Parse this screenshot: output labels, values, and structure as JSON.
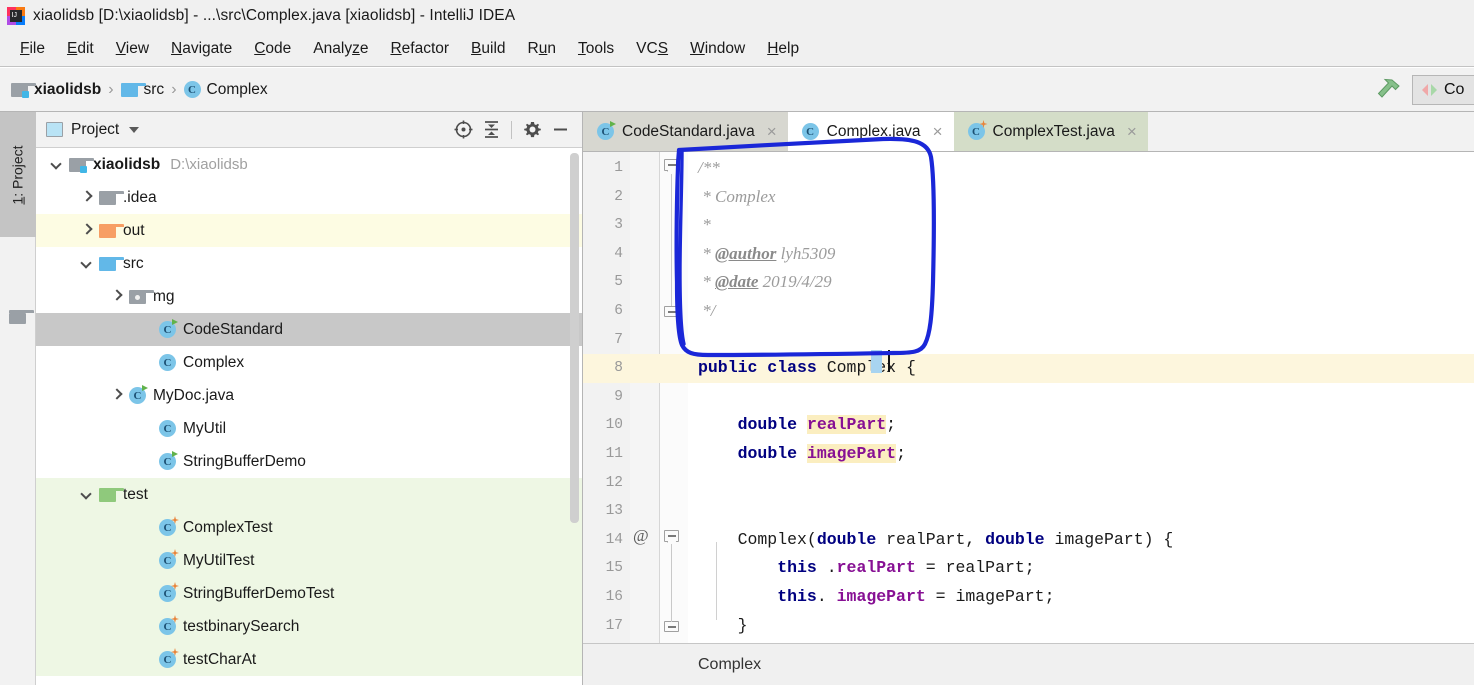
{
  "window": {
    "title": "xiaolidsb [D:\\xiaolidsb] - ...\\src\\Complex.java [xiaolidsb] - IntelliJ IDEA",
    "app_icon": "intellij-idea-icon"
  },
  "menubar": {
    "items": [
      {
        "label": "File",
        "mnemonic": "F"
      },
      {
        "label": "Edit",
        "mnemonic": "E"
      },
      {
        "label": "View",
        "mnemonic": "V"
      },
      {
        "label": "Navigate",
        "mnemonic": "N"
      },
      {
        "label": "Code",
        "mnemonic": "C"
      },
      {
        "label": "Analyze",
        "mnemonic": "z"
      },
      {
        "label": "Refactor",
        "mnemonic": "R"
      },
      {
        "label": "Build",
        "mnemonic": "B"
      },
      {
        "label": "Run",
        "mnemonic": "u"
      },
      {
        "label": "Tools",
        "mnemonic": "T"
      },
      {
        "label": "VCS",
        "mnemonic": "S"
      },
      {
        "label": "Window",
        "mnemonic": "W"
      },
      {
        "label": "Help",
        "mnemonic": "H"
      }
    ]
  },
  "navbar": {
    "breadcrumbs": [
      {
        "label": "xiaolidsb",
        "icon": "module-folder-icon",
        "bold": true
      },
      {
        "label": "src",
        "icon": "source-folder-icon",
        "bold": false
      },
      {
        "label": "Complex",
        "icon": "java-class-icon",
        "bold": false
      }
    ],
    "separator": "›",
    "build_icon": "hammer-icon",
    "toolwindow_button_label": "Co",
    "toolwindow_button_icon": "resize-arrows-icon"
  },
  "left_strip": {
    "project_tab_label": "1: Project",
    "project_tab_mnemonic": "1",
    "structure_icon": "folder-icon"
  },
  "project_panel": {
    "title": "Project",
    "title_icon": "project-view-icon",
    "dropdown_icon": "chevron-down-icon",
    "actions": [
      {
        "name": "locate-in-tree-icon",
        "tooltip": "Select Opened File"
      },
      {
        "name": "collapse-all-icon",
        "tooltip": "Collapse All"
      },
      {
        "name": "gear-icon",
        "tooltip": "Settings"
      },
      {
        "name": "minimize-icon",
        "tooltip": "Hide"
      }
    ],
    "tree": [
      {
        "label": "xiaolidsb",
        "sub": "D:\\xiaolidsb",
        "depth": 0,
        "arrow": "expanded",
        "icon": "module-folder-icon",
        "bold": true,
        "state": "normal"
      },
      {
        "label": ".idea",
        "sub": "",
        "depth": 1,
        "arrow": "collapsed",
        "icon": "gray-folder-icon",
        "bold": false,
        "state": "normal"
      },
      {
        "label": "out",
        "sub": "",
        "depth": 1,
        "arrow": "collapsed",
        "icon": "orange-folder-icon",
        "bold": false,
        "state": "excluded"
      },
      {
        "label": "src",
        "sub": "",
        "depth": 1,
        "arrow": "expanded",
        "icon": "blue-folder-icon",
        "bold": false,
        "state": "normal"
      },
      {
        "label": "mg",
        "sub": "",
        "depth": 2,
        "arrow": "collapsed",
        "icon": "package-folder-icon",
        "bold": false,
        "state": "normal"
      },
      {
        "label": "CodeStandard",
        "sub": "",
        "depth": 3,
        "arrow": "none",
        "icon": "java-class-runnable-icon",
        "bold": false,
        "state": "selected"
      },
      {
        "label": "Complex",
        "sub": "",
        "depth": 3,
        "arrow": "none",
        "icon": "java-class-icon",
        "bold": false,
        "state": "normal"
      },
      {
        "label": "MyDoc.java",
        "sub": "",
        "depth": 2,
        "arrow": "collapsed",
        "icon": "java-class-runnable-icon",
        "bold": false,
        "state": "normal"
      },
      {
        "label": "MyUtil",
        "sub": "",
        "depth": 3,
        "arrow": "none",
        "icon": "java-class-icon",
        "bold": false,
        "state": "normal"
      },
      {
        "label": "StringBufferDemo",
        "sub": "",
        "depth": 3,
        "arrow": "none",
        "icon": "java-class-runnable-icon",
        "bold": false,
        "state": "normal"
      },
      {
        "label": "test",
        "sub": "",
        "depth": 1,
        "arrow": "expanded",
        "icon": "green-folder-icon",
        "bold": false,
        "state": "test"
      },
      {
        "label": "ComplexTest",
        "sub": "",
        "depth": 3,
        "arrow": "none",
        "icon": "java-test-class-icon",
        "bold": false,
        "state": "test"
      },
      {
        "label": "MyUtilTest",
        "sub": "",
        "depth": 3,
        "arrow": "none",
        "icon": "java-test-class-icon",
        "bold": false,
        "state": "test"
      },
      {
        "label": "StringBufferDemoTest",
        "sub": "",
        "depth": 3,
        "arrow": "none",
        "icon": "java-test-class-icon",
        "bold": false,
        "state": "test"
      },
      {
        "label": "testbinarySearch",
        "sub": "",
        "depth": 3,
        "arrow": "none",
        "icon": "java-test-class-icon",
        "bold": false,
        "state": "test"
      },
      {
        "label": "testCharAt",
        "sub": "",
        "depth": 3,
        "arrow": "none",
        "icon": "java-test-class-icon",
        "bold": false,
        "state": "test"
      }
    ]
  },
  "editor": {
    "tabs": [
      {
        "label": "CodeStandard.java",
        "icon": "java-class-runnable-icon",
        "active": false,
        "style": "gray",
        "close": "×"
      },
      {
        "label": "Complex.java",
        "icon": "java-class-icon",
        "active": true,
        "style": "white",
        "close": "×"
      },
      {
        "label": "ComplexTest.java",
        "icon": "java-test-class-icon",
        "active": false,
        "style": "green",
        "close": "×"
      }
    ],
    "lines": [
      {
        "n": "1",
        "type": "comment",
        "text": "/**",
        "highlight": false
      },
      {
        "n": "2",
        "type": "comment",
        "text": " * Complex",
        "highlight": false
      },
      {
        "n": "3",
        "type": "comment",
        "text": " *",
        "highlight": false
      },
      {
        "n": "4",
        "type": "javadoc",
        "tag": " * @author",
        "rest": " lyh5309",
        "highlight": false
      },
      {
        "n": "5",
        "type": "javadoc",
        "tag": " * @date",
        "rest": " 2019/4/29",
        "highlight": false
      },
      {
        "n": "6",
        "type": "comment",
        "text": " */",
        "highlight": false
      },
      {
        "n": "7",
        "type": "blank",
        "text": "",
        "highlight": false
      },
      {
        "n": "8",
        "type": "classdecl",
        "text": "public class Complex {",
        "highlight": true
      },
      {
        "n": "9",
        "type": "blank",
        "text": "",
        "highlight": false
      },
      {
        "n": "10",
        "type": "field",
        "text": "    double realPart;",
        "highlight": false
      },
      {
        "n": "11",
        "type": "field",
        "text": "    double imagePart;",
        "highlight": false
      },
      {
        "n": "12",
        "type": "blank",
        "text": "",
        "highlight": false
      },
      {
        "n": "13",
        "type": "blank",
        "text": "",
        "highlight": false
      },
      {
        "n": "14",
        "type": "ctor",
        "text": "    Complex(double realPart, double imagePart) {",
        "highlight": false
      },
      {
        "n": "15",
        "type": "assign",
        "text": "        this .realPart = realPart;",
        "highlight": false
      },
      {
        "n": "16",
        "type": "assign",
        "text": "        this. imagePart = imagePart;",
        "highlight": false
      },
      {
        "n": "17",
        "type": "close",
        "text": "    }",
        "highlight": false
      }
    ],
    "gutter_at_marker": "@",
    "caret_line": "8",
    "status_text": "Complex"
  },
  "annotation": {
    "shape": "hand-drawn-rectangle",
    "color": "#1a27d8",
    "target": "javadoc-comment-block"
  },
  "colors": {
    "selection_row": "#c8c8c8",
    "excluded_row": "#fdfce3",
    "test_row": "#eef7e4",
    "caret_line": "#fdf6dd",
    "field_highlight": "#fbeec0",
    "keyword": "#000080",
    "field_name": "#871094",
    "comment": "#9b9b9b",
    "annotation_blue": "#1a27d8"
  }
}
